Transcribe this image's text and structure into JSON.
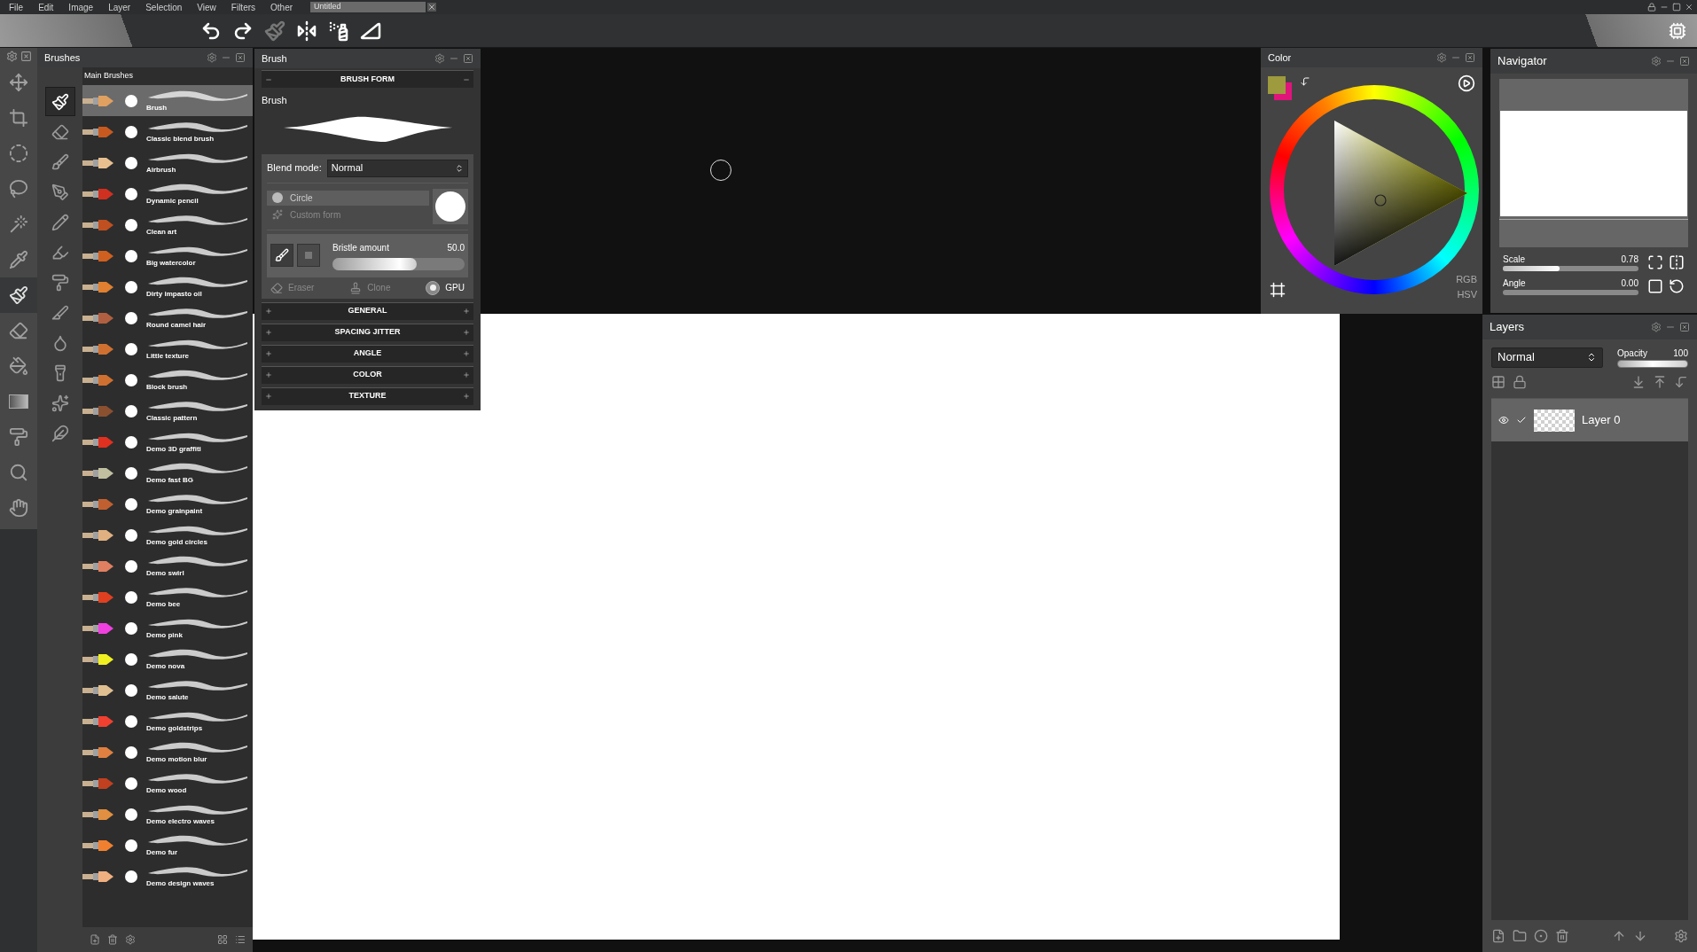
{
  "menu": [
    "File",
    "Edit",
    "Image",
    "Layer",
    "Selection",
    "View",
    "Filters",
    "Other"
  ],
  "document_tab": {
    "title": "Untitled"
  },
  "toolbar": [
    {
      "kind": "undo",
      "disabled": false
    },
    {
      "kind": "redo",
      "disabled": false
    },
    {
      "kind": "brush",
      "disabled": true
    },
    {
      "kind": "symmetry",
      "disabled": false
    },
    {
      "kind": "spray",
      "disabled": false
    },
    {
      "kind": "ruler",
      "disabled": false
    }
  ],
  "tools": [
    {
      "kind": "move",
      "selected": false
    },
    {
      "kind": "crop",
      "selected": false
    },
    {
      "kind": "ellipse",
      "selected": false
    },
    {
      "kind": "lasso",
      "selected": false
    },
    {
      "kind": "wand",
      "selected": false
    },
    {
      "kind": "picker",
      "selected": false
    },
    {
      "kind": "brush",
      "selected": true
    },
    {
      "kind": "eraser",
      "selected": false
    },
    {
      "kind": "fill",
      "selected": false
    },
    {
      "kind": "gradient",
      "selected": false
    },
    {
      "kind": "roller",
      "selected": false
    },
    {
      "kind": "zoom",
      "selected": false
    },
    {
      "kind": "hand",
      "selected": false
    }
  ],
  "brushes_panel": {
    "title": "Brushes",
    "group": "Main Brushes",
    "subtools": [
      {
        "kind": "paintbrush",
        "selected": true
      },
      {
        "kind": "eraser",
        "selected": false
      },
      {
        "kind": "brush",
        "selected": false
      },
      {
        "kind": "pen",
        "selected": false
      },
      {
        "kind": "pencil",
        "selected": false
      },
      {
        "kind": "marker",
        "selected": false
      },
      {
        "kind": "roller",
        "selected": false
      },
      {
        "kind": "knife",
        "selected": false
      },
      {
        "kind": "drop",
        "selected": false
      },
      {
        "kind": "lamp",
        "selected": false
      },
      {
        "kind": "stars",
        "selected": false
      },
      {
        "kind": "feather",
        "selected": false
      }
    ],
    "items": [
      {
        "name": "Brush",
        "color": "#e0a060",
        "selected": true
      },
      {
        "name": "Classic blend brush",
        "color": "#c85a20",
        "selected": false
      },
      {
        "name": "Airbrush",
        "color": "#e8c090",
        "selected": false
      },
      {
        "name": "Dynamic pencil",
        "color": "#d03020",
        "selected": false
      },
      {
        "name": "Clean art",
        "color": "#c05020",
        "selected": false
      },
      {
        "name": "Big watercolor",
        "color": "#d06020",
        "selected": false
      },
      {
        "name": "Dirty impasto oil",
        "color": "#e08030",
        "selected": false
      },
      {
        "name": "Round camel hair",
        "color": "#b06040",
        "selected": false
      },
      {
        "name": "Little texture",
        "color": "#d07030",
        "selected": false
      },
      {
        "name": "Block brush",
        "color": "#d07030",
        "selected": false
      },
      {
        "name": "Classic pattern",
        "color": "#8a5030",
        "selected": false
      },
      {
        "name": "Demo 3D graffiti",
        "color": "#e03020",
        "selected": false
      },
      {
        "name": "Demo fast BG",
        "color": "#c0c0a0",
        "selected": false
      },
      {
        "name": "Demo grainpaint",
        "color": "#c06030",
        "selected": false
      },
      {
        "name": "Demo gold circles",
        "color": "#e0b080",
        "selected": false
      },
      {
        "name": "Demo swirl",
        "color": "#e08060",
        "selected": false
      },
      {
        "name": "Demo bee",
        "color": "#e04020",
        "selected": false
      },
      {
        "name": "Demo pink",
        "color": "#f040e0",
        "selected": false
      },
      {
        "name": "Demo nova",
        "color": "#f0f020",
        "selected": false
      },
      {
        "name": "Demo salute",
        "color": "#e0c090",
        "selected": false
      },
      {
        "name": "Demo goldstrips",
        "color": "#f04030",
        "selected": false
      },
      {
        "name": "Demo motion blur",
        "color": "#e08040",
        "selected": false
      },
      {
        "name": "Demo wood",
        "color": "#c04020",
        "selected": false
      },
      {
        "name": "Demo electro waves",
        "color": "#e09040",
        "selected": false
      },
      {
        "name": "Demo fur",
        "color": "#f08030",
        "selected": false
      },
      {
        "name": "Demo design waves",
        "color": "#f0b080",
        "selected": false
      }
    ]
  },
  "brush_panel": {
    "title": "Brush",
    "preview_label": "Brush",
    "blend_label": "Blend mode:",
    "blend_value": "Normal",
    "forms": [
      {
        "label": "Circle",
        "selected": true
      },
      {
        "label": "Custom form",
        "selected": false
      }
    ],
    "modes": [
      {
        "kind": "brush",
        "selected": true
      },
      {
        "kind": "square",
        "selected": false
      }
    ],
    "bristle": {
      "label": "Bristle amount",
      "value": "50.0",
      "level": 0.64
    },
    "options": [
      {
        "kind": "eraser",
        "label": "Eraser",
        "on": false
      },
      {
        "kind": "clone",
        "label": "Clone",
        "on": false
      },
      {
        "kind": "gpu",
        "label": "GPU",
        "on": true
      }
    ],
    "sections": [
      {
        "label": "BRUSH FORM",
        "expanded": true
      },
      {
        "label": "GENERAL",
        "expanded": false
      },
      {
        "label": "SPACING JITTER",
        "expanded": false
      },
      {
        "label": "ANGLE",
        "expanded": false
      },
      {
        "label": "COLOR",
        "expanded": false
      },
      {
        "label": "TEXTURE",
        "expanded": false
      }
    ]
  },
  "color_panel": {
    "title": "Color",
    "swatches": [
      {
        "kind": "foreground",
        "color": "#9e9a3e"
      },
      {
        "kind": "background",
        "color": "#e0157a"
      }
    ],
    "modes": [
      "RGB",
      "HSV"
    ]
  },
  "navigator": {
    "title": "Navigator",
    "scale": {
      "label": "Scale",
      "value": "0.78",
      "level": 0.42
    },
    "angle": {
      "label": "Angle",
      "value": "0.00",
      "level": 0
    }
  },
  "layers": {
    "title": "Layers",
    "blend": "Normal",
    "opacity": {
      "label": "Opacity",
      "value": "100",
      "level": 1
    },
    "items": [
      {
        "name": "Layer 0",
        "visible": true,
        "checked": true,
        "selected": true
      }
    ]
  }
}
